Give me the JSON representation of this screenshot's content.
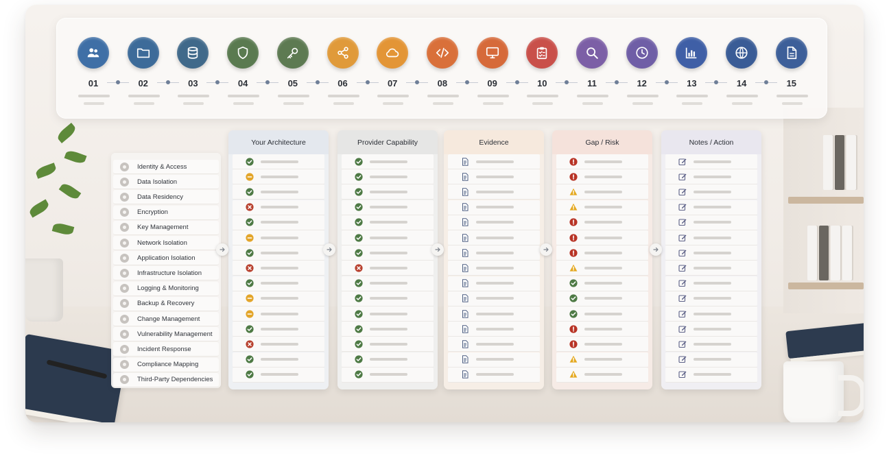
{
  "steps": [
    {
      "num": "01",
      "icon": "users-icon",
      "color": "#3f6fa6"
    },
    {
      "num": "02",
      "icon": "folder-icon",
      "color": "#3d6b99"
    },
    {
      "num": "03",
      "icon": "database-icon",
      "color": "#40698a"
    },
    {
      "num": "04",
      "icon": "shield-icon",
      "color": "#5a7a50"
    },
    {
      "num": "05",
      "icon": "key-icon",
      "color": "#5d7a52"
    },
    {
      "num": "06",
      "icon": "share-icon",
      "color": "#e09a3a"
    },
    {
      "num": "07",
      "icon": "cloud-icon",
      "color": "#e39536"
    },
    {
      "num": "08",
      "icon": "code-icon",
      "color": "#d9703a"
    },
    {
      "num": "09",
      "icon": "monitor-icon",
      "color": "#d66a3a"
    },
    {
      "num": "10",
      "icon": "clipboard-icon",
      "color": "#c9504a"
    },
    {
      "num": "11",
      "icon": "search-icon",
      "color": "#7c5fa6"
    },
    {
      "num": "12",
      "icon": "clock-icon",
      "color": "#6f5ea6"
    },
    {
      "num": "13",
      "icon": "bar-chart-icon",
      "color": "#3f5fa6"
    },
    {
      "num": "14",
      "icon": "globe-icon",
      "color": "#3a5c96"
    },
    {
      "num": "15",
      "icon": "document-icon",
      "color": "#3d5f99"
    }
  ],
  "categories": [
    "Identity & Access",
    "Data Isolation",
    "Data Residency",
    "Encryption",
    "Key Management",
    "Network Isolation",
    "Application Isolation",
    "Infrastructure Isolation",
    "Logging & Monitoring",
    "Backup & Recovery",
    "Change Management",
    "Vulnerability Management",
    "Incident Response",
    "Compliance Mapping",
    "Third-Party Dependencies"
  ],
  "columns": [
    {
      "title": "Your Architecture",
      "head_color": "#e4e8ee",
      "body_color": "#eef0f3",
      "rows": [
        "check",
        "partial",
        "check",
        "fail",
        "check",
        "partial",
        "check",
        "fail",
        "check",
        "partial",
        "partial",
        "check",
        "fail",
        "check",
        "check"
      ]
    },
    {
      "title": "Provider Capability",
      "head_color": "#e6e6e5",
      "body_color": "#efefee",
      "rows": [
        "check",
        "check",
        "check",
        "check",
        "check",
        "check",
        "check",
        "fail",
        "check",
        "check",
        "check",
        "check",
        "check",
        "check",
        "check"
      ]
    },
    {
      "title": "Evidence",
      "head_color": "#f6e9dd",
      "body_color": "#f6eee6",
      "rows": [
        "document",
        "document",
        "document",
        "document",
        "document",
        "document",
        "document",
        "document",
        "document",
        "document",
        "document",
        "document",
        "document",
        "document",
        "document"
      ]
    },
    {
      "title": "Gap / Risk",
      "head_color": "#f5e2db",
      "body_color": "#f6ebe6",
      "rows": [
        "error",
        "error",
        "warning",
        "warning",
        "error",
        "error",
        "error",
        "warning",
        "check",
        "check",
        "check",
        "error",
        "error",
        "warning",
        "warning"
      ]
    },
    {
      "title": "Notes / Action",
      "head_color": "#e9e7ef",
      "body_color": "#f0eff3",
      "rows": [
        "edit",
        "edit",
        "edit",
        "edit",
        "edit",
        "edit",
        "edit",
        "edit",
        "edit",
        "edit",
        "edit",
        "edit",
        "edit",
        "edit",
        "edit"
      ]
    }
  ],
  "status_colors": {
    "check": "#4e7a45",
    "partial": "#e3a52a",
    "fail": "#b8412f",
    "error": "#b83426",
    "warning": "#e4a81f",
    "document": "#4e5f82",
    "edit": "#5b5f86"
  }
}
